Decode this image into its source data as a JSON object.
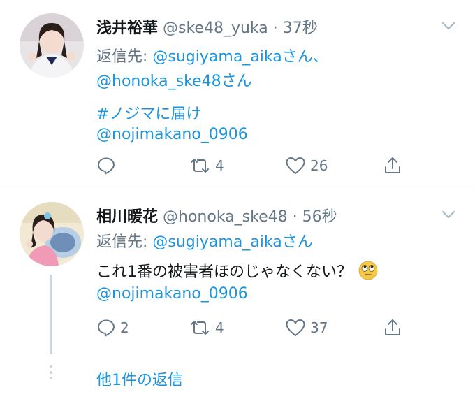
{
  "tweets": [
    {
      "name": "浅井裕華",
      "handle": "@ske48_yuka",
      "separator": "·",
      "time": "37秒",
      "reply_prefix": "返信先: ",
      "reply_to_1": "@sugiyama_aikaさん、",
      "reply_to_2": "@honoka_ske48さん",
      "hashtag": "#ノジマに届け",
      "mention": "@nojimakano_0906",
      "actions": {
        "reply_count": "",
        "retweet_count": "4",
        "like_count": "26"
      }
    },
    {
      "name": "相川暖花",
      "handle": "@honoka_ske48",
      "separator": "·",
      "time": "56秒",
      "reply_prefix": "返信先: ",
      "reply_to_1": "@sugiyama_aikaさん",
      "body": "これ1番の被害者ほのじゃなくない？",
      "mention": "@nojimakano_0906",
      "actions": {
        "reply_count": "2",
        "retweet_count": "4",
        "like_count": "37"
      }
    }
  ],
  "more_replies": "他1件の返信",
  "icons": [
    "chevron-down-icon",
    "reply-icon",
    "retweet-icon",
    "like-icon",
    "share-icon",
    "eye-roll-emoji"
  ],
  "colors": {
    "link": "#1b95e0",
    "muted": "#657786",
    "divider": "#e6ecf0"
  }
}
